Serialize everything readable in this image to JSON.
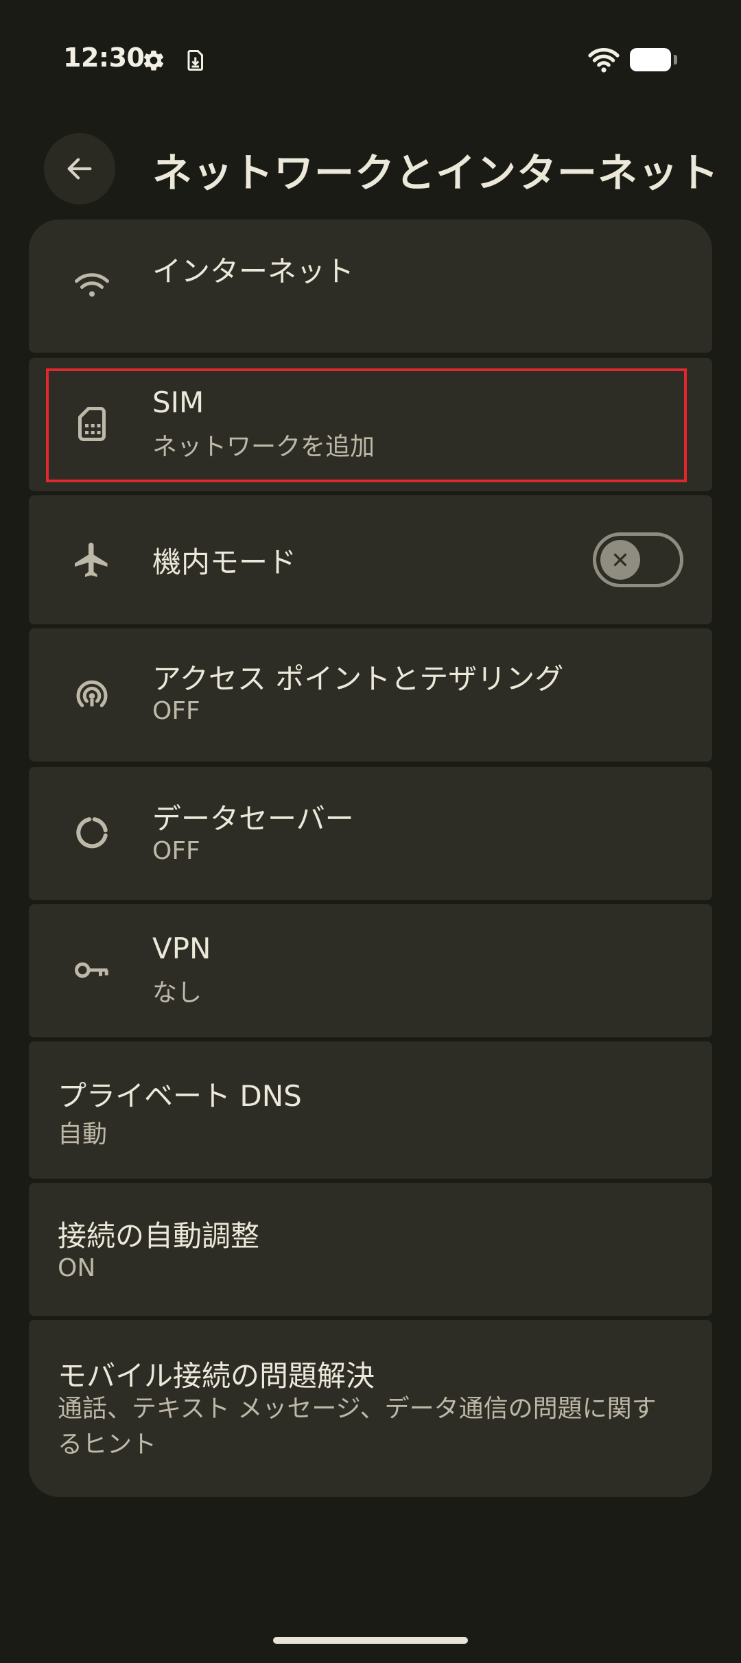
{
  "status_bar": {
    "time": "12:30",
    "icons": [
      "settings-gear-icon",
      "download-icon",
      "wifi-icon",
      "battery-icon"
    ]
  },
  "header": {
    "back_icon": "arrow-back-icon",
    "title": "ネットワークとインターネット"
  },
  "items": [
    {
      "id": "internet",
      "icon": "wifi-icon",
      "title": "インターネット",
      "subtitle": ""
    },
    {
      "id": "sim",
      "icon": "sim-card-icon",
      "title": "SIM",
      "subtitle": "ネットワークを追加"
    },
    {
      "id": "airplane",
      "icon": "airplane-icon",
      "title": "機内モード",
      "toggle": "off"
    },
    {
      "id": "hotspot",
      "icon": "hotspot-icon",
      "title": "アクセス ポイントとテザリング",
      "subtitle": "OFF"
    },
    {
      "id": "data_saver",
      "icon": "data-saver-icon",
      "title": "データセーバー",
      "subtitle": "OFF"
    },
    {
      "id": "vpn",
      "icon": "vpn-key-icon",
      "title": "VPN",
      "subtitle": "なし"
    },
    {
      "id": "private_dns",
      "title": "プライベート DNS",
      "subtitle": "自動"
    },
    {
      "id": "adaptive",
      "title": "接続の自動調整",
      "subtitle": "ON"
    },
    {
      "id": "mobile_troubleshoot",
      "title": "モバイル接続の問題解決",
      "subtitle": "通話、テキスト メッセージ、データ通信の問題に関するヒント"
    }
  ],
  "colors": {
    "background": "#1b1b15",
    "card": "#2e2d25",
    "highlight": "#e0282e"
  }
}
